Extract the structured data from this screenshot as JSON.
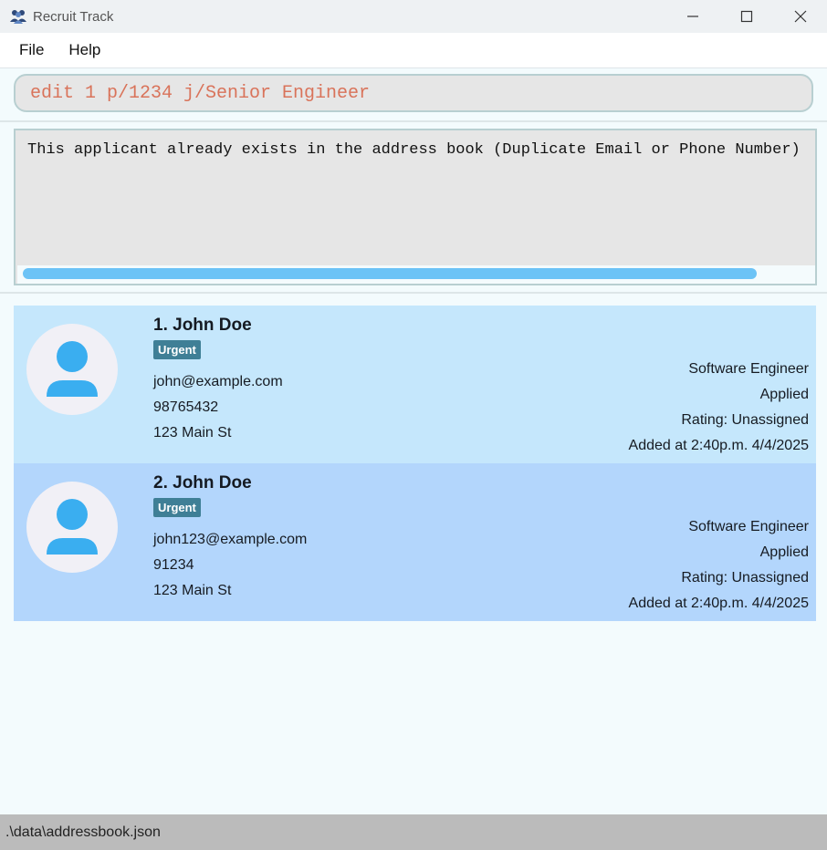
{
  "window": {
    "title": "Recruit Track",
    "icon": "people-group-icon",
    "controls": [
      "minimize-icon",
      "maximize-icon",
      "close-icon"
    ]
  },
  "menu": {
    "items": [
      "File",
      "Help"
    ]
  },
  "command": {
    "value": "edit 1 p/1234 j/Senior Engineer",
    "color": "#d9735a"
  },
  "result": {
    "text": "This applicant already exists in the address book (Duplicate Email or Phone Number)"
  },
  "applicants": [
    {
      "index_name": "1. John Doe",
      "tag": "Urgent",
      "email": "john@example.com",
      "phone": "98765432",
      "address": "123 Main St",
      "job": "Software Engineer",
      "status": "Applied",
      "rating": "Rating: Unassigned",
      "added": "Added at 2:40p.m. 4/4/2025"
    },
    {
      "index_name": "2. John Doe",
      "tag": "Urgent",
      "email": "john123@example.com",
      "phone": "91234",
      "address": "123 Main St",
      "job": "Software Engineer",
      "status": "Applied",
      "rating": "Rating: Unassigned",
      "added": "Added at 2:40p.m. 4/4/2025"
    }
  ],
  "statusbar": {
    "path": ".\\data\\addressbook.json"
  },
  "colors": {
    "card1": "#c5e7fc",
    "card2": "#b3d6fc",
    "tag": "#3f7f96",
    "avatar_icon": "#3aaef0"
  }
}
